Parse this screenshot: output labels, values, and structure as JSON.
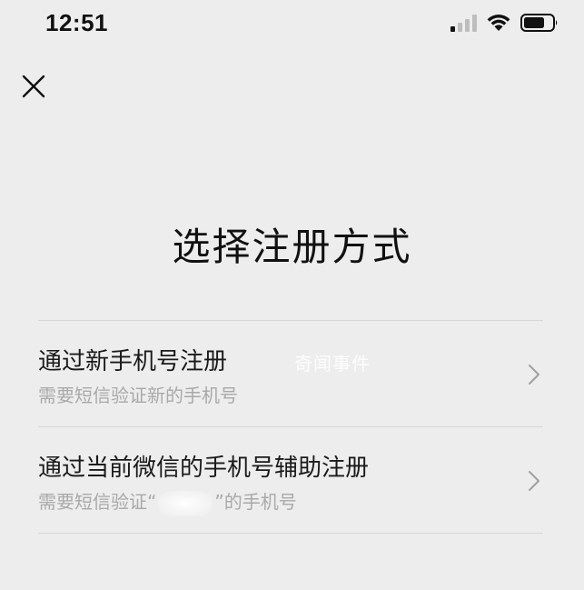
{
  "status_bar": {
    "time": "12:51",
    "signal_icon": "cellular-signal-icon",
    "wifi_icon": "wifi-icon",
    "battery_icon": "battery-icon"
  },
  "header": {
    "close_icon": "close-icon"
  },
  "page": {
    "title": "选择注册方式"
  },
  "options": [
    {
      "title": "通过新手机号注册",
      "subtitle": "需要短信验证新的手机号"
    },
    {
      "title": "通过当前微信的手机号辅助注册",
      "subtitle_prefix": "需要短信验证“",
      "subtitle_suffix": "”的手机号"
    }
  ],
  "watermark": {
    "text": "奇闻事件"
  },
  "colors": {
    "background": "#ededed",
    "text_primary": "#1a1a1a",
    "text_secondary": "#a9a9a9",
    "divider": "#d7d7d7"
  }
}
